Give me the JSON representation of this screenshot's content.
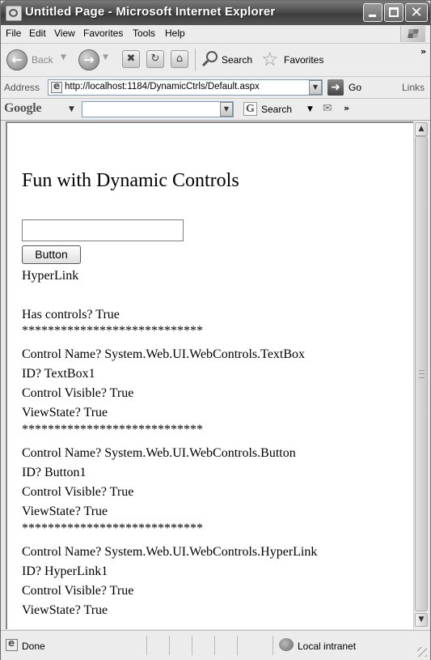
{
  "window": {
    "title": "Untitled Page - Microsoft Internet Explorer",
    "close_glyph": "✕"
  },
  "menu": {
    "items": [
      "File",
      "Edit",
      "View",
      "Favorites",
      "Tools",
      "Help"
    ]
  },
  "toolbar": {
    "back_label": "Back",
    "search_label": "Search",
    "favorites_label": "Favorites",
    "overflow": "»"
  },
  "address": {
    "label": "Address",
    "url": "http://localhost:1184/DynamicCtrls/Default.aspx",
    "go_label": "Go",
    "links_label": "Links"
  },
  "google": {
    "logo": "Google",
    "search_label": "Search",
    "overflow": "»",
    "input_value": ""
  },
  "page": {
    "heading": "Fun with Dynamic Controls",
    "textbox_value": "",
    "button_label": "Button",
    "hyperlink_label": "HyperLink",
    "has_controls": "Has controls? True",
    "separator": "****************************",
    "controls": [
      {
        "name": "Control Name? System.Web.UI.WebControls.TextBox",
        "id": "ID? TextBox1",
        "visible": "Control Visible? True",
        "viewstate": "ViewState? True"
      },
      {
        "name": "Control Name? System.Web.UI.WebControls.Button",
        "id": "ID? Button1",
        "visible": "Control Visible? True",
        "viewstate": "ViewState? True"
      },
      {
        "name": "Control Name? System.Web.UI.WebControls.HyperLink",
        "id": "ID? HyperLink1",
        "visible": "Control Visible? True",
        "viewstate": "ViewState? True"
      }
    ]
  },
  "status": {
    "text": "Done",
    "zone": "Local intranet"
  }
}
